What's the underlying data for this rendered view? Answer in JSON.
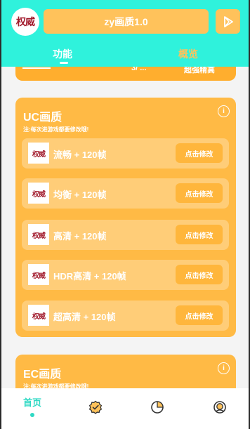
{
  "header": {
    "logo_text": "权威",
    "title": "zy画质1.0",
    "tabs": [
      {
        "label": "功能",
        "active": true
      },
      {
        "label": "概览",
        "active": false
      }
    ]
  },
  "prev_card": {
    "partial_text": "超强精高",
    "partial_dots": "3/ ..."
  },
  "uc_card": {
    "title": "UC画质",
    "note": "注:每次进游戏都要修改哦!",
    "rows": [
      {
        "logo": "权威",
        "label": "流畅 + 120帧",
        "button": "点击修改"
      },
      {
        "logo": "权威",
        "label": "均衡 + 120帧",
        "button": "点击修改"
      },
      {
        "logo": "权威",
        "label": "高清 + 120帧",
        "button": "点击修改"
      },
      {
        "logo": "权威",
        "label": "HDR高清 + 120帧",
        "button": "点击修改"
      },
      {
        "logo": "权威",
        "label": "超高清 + 120帧",
        "button": "点击修改"
      }
    ]
  },
  "ec_card": {
    "title": "EC画质",
    "note": "注:每次进游戏都要修改哦!"
  },
  "bottom_nav": {
    "home_label": "首页",
    "items": [
      "home",
      "verified-badge-icon",
      "pie-chart-icon",
      "profile-icon"
    ]
  },
  "colors": {
    "header_bg": "#2ff2dc",
    "accent": "#ffc25b",
    "card": "#ffba45",
    "row": "#ffcd78",
    "nav_active": "#2fd9c4"
  }
}
